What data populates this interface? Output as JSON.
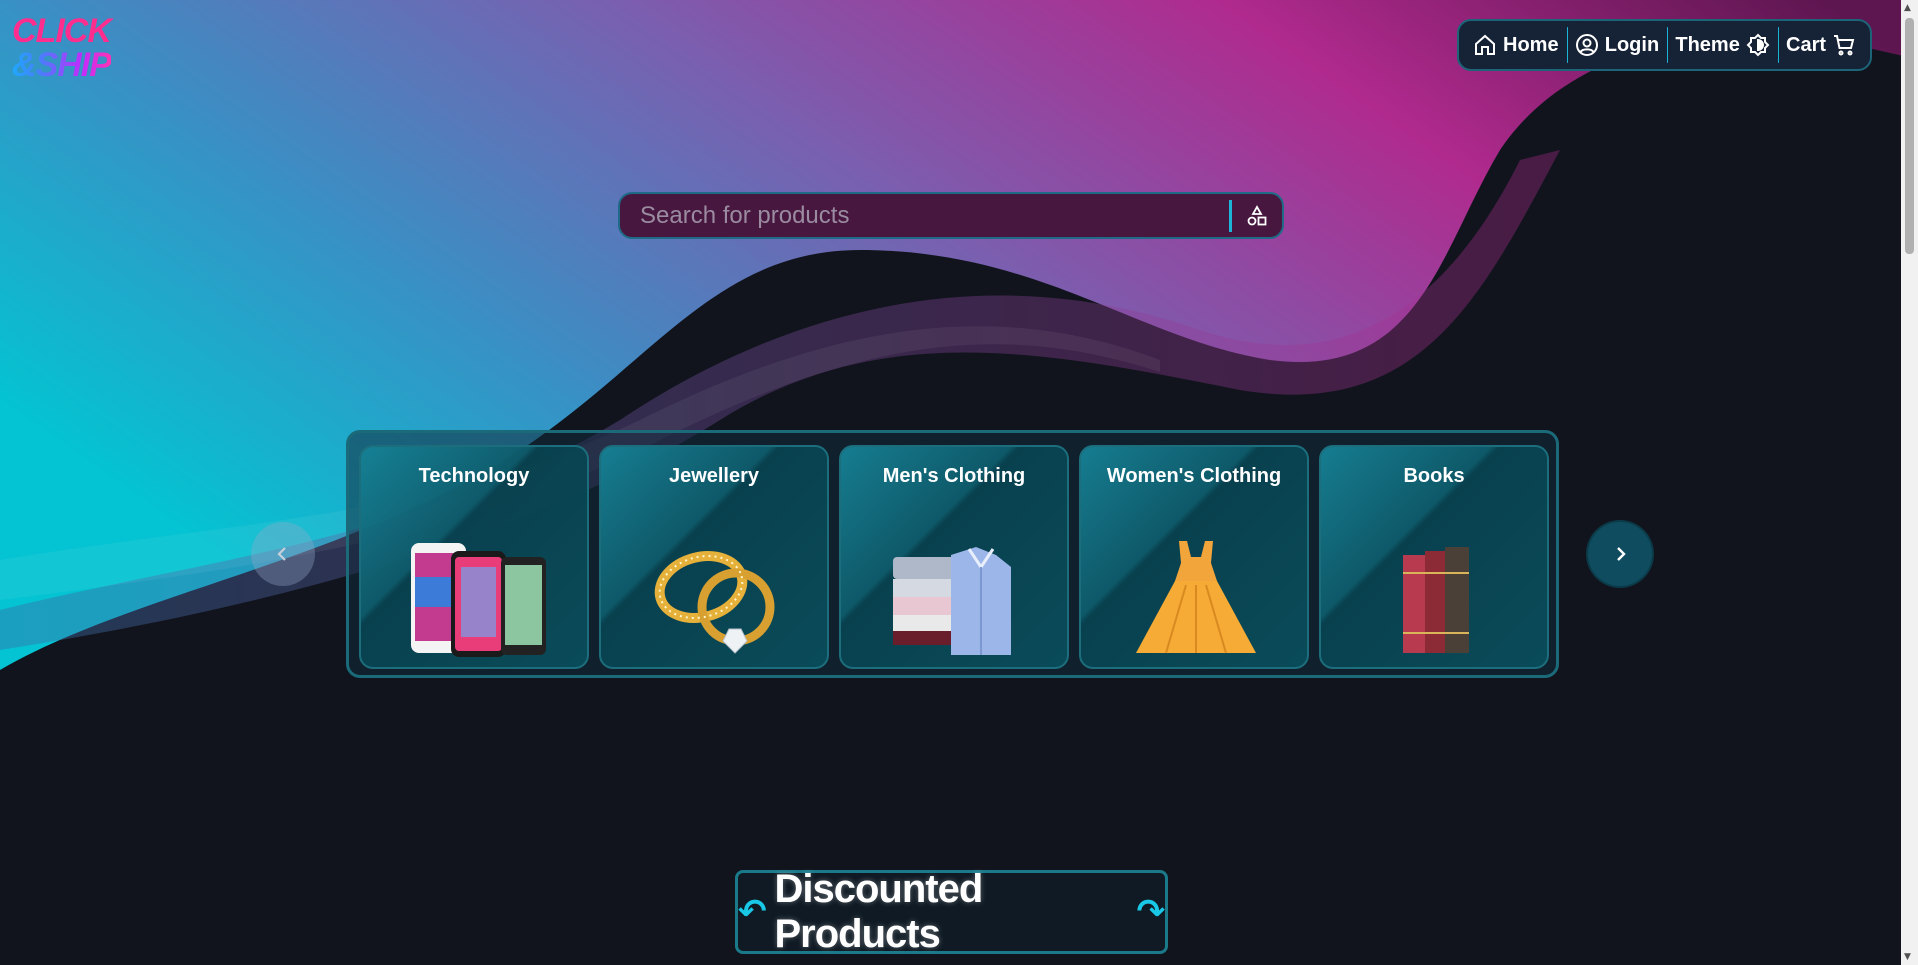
{
  "logo": {
    "line1": "CLICK",
    "line2": "&SHIP"
  },
  "nav": {
    "items": [
      {
        "label": "Home",
        "icon": "home-icon"
      },
      {
        "label": "Login",
        "icon": "user-circle-icon"
      },
      {
        "label": "Theme",
        "icon": "theme-toggle-icon"
      },
      {
        "label": "Cart",
        "icon": "cart-icon"
      }
    ]
  },
  "search": {
    "placeholder": "Search for products",
    "filter_icon": "shapes-filter-icon"
  },
  "categories": [
    {
      "label": "Technology",
      "icon": "smartphones-image"
    },
    {
      "label": "Jewellery",
      "icon": "rings-image"
    },
    {
      "label": "Men's Clothing",
      "icon": "shirts-image"
    },
    {
      "label": "Women's Clothing",
      "icon": "dress-image"
    },
    {
      "label": "Books",
      "icon": "books-image"
    }
  ],
  "carousel": {
    "prev_icon": "chevron-left-icon",
    "next_icon": "chevron-right-icon"
  },
  "discounted": {
    "title": "Discounted Products"
  },
  "colors": {
    "accent": "#1bb3d6",
    "brand_pink": "#ff2d8d",
    "background": "#11141d"
  }
}
